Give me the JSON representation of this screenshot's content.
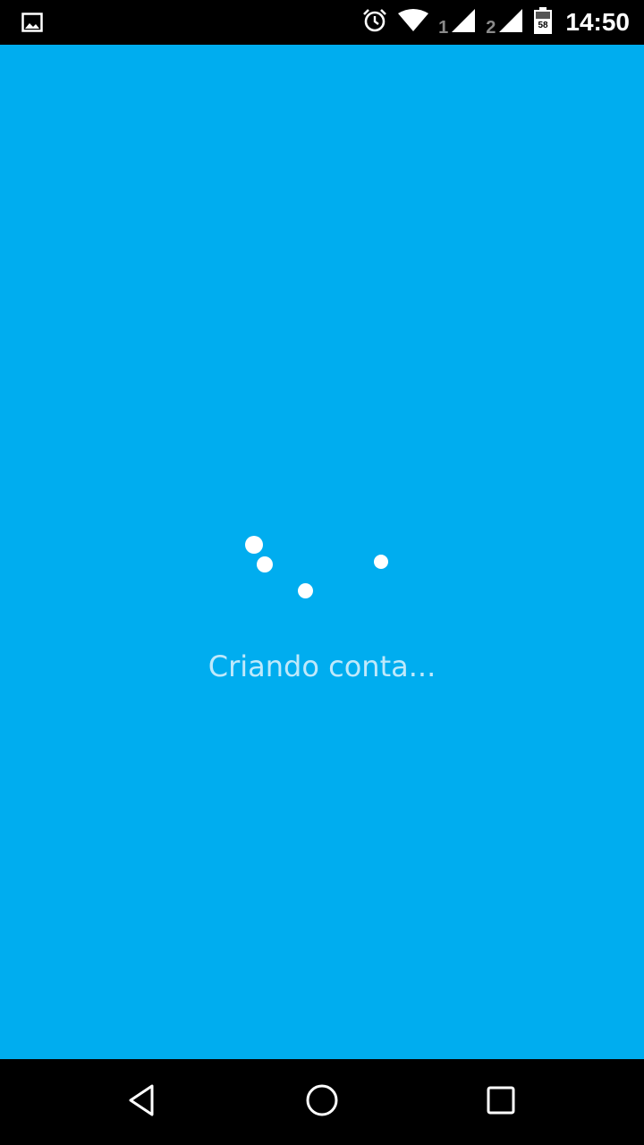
{
  "status_bar": {
    "time": "14:50",
    "sim1_label": "1",
    "sim2_label": "2",
    "battery_level": "58",
    "icons": [
      "image-notification-icon",
      "alarm-icon",
      "wifi-icon",
      "signal-sim1-icon",
      "signal-sim2-icon",
      "battery-icon"
    ]
  },
  "main": {
    "status_text": "Criando conta...",
    "background_color": "#00adef"
  },
  "nav_bar": {
    "icons": [
      "back-icon",
      "home-icon",
      "recents-icon"
    ]
  }
}
